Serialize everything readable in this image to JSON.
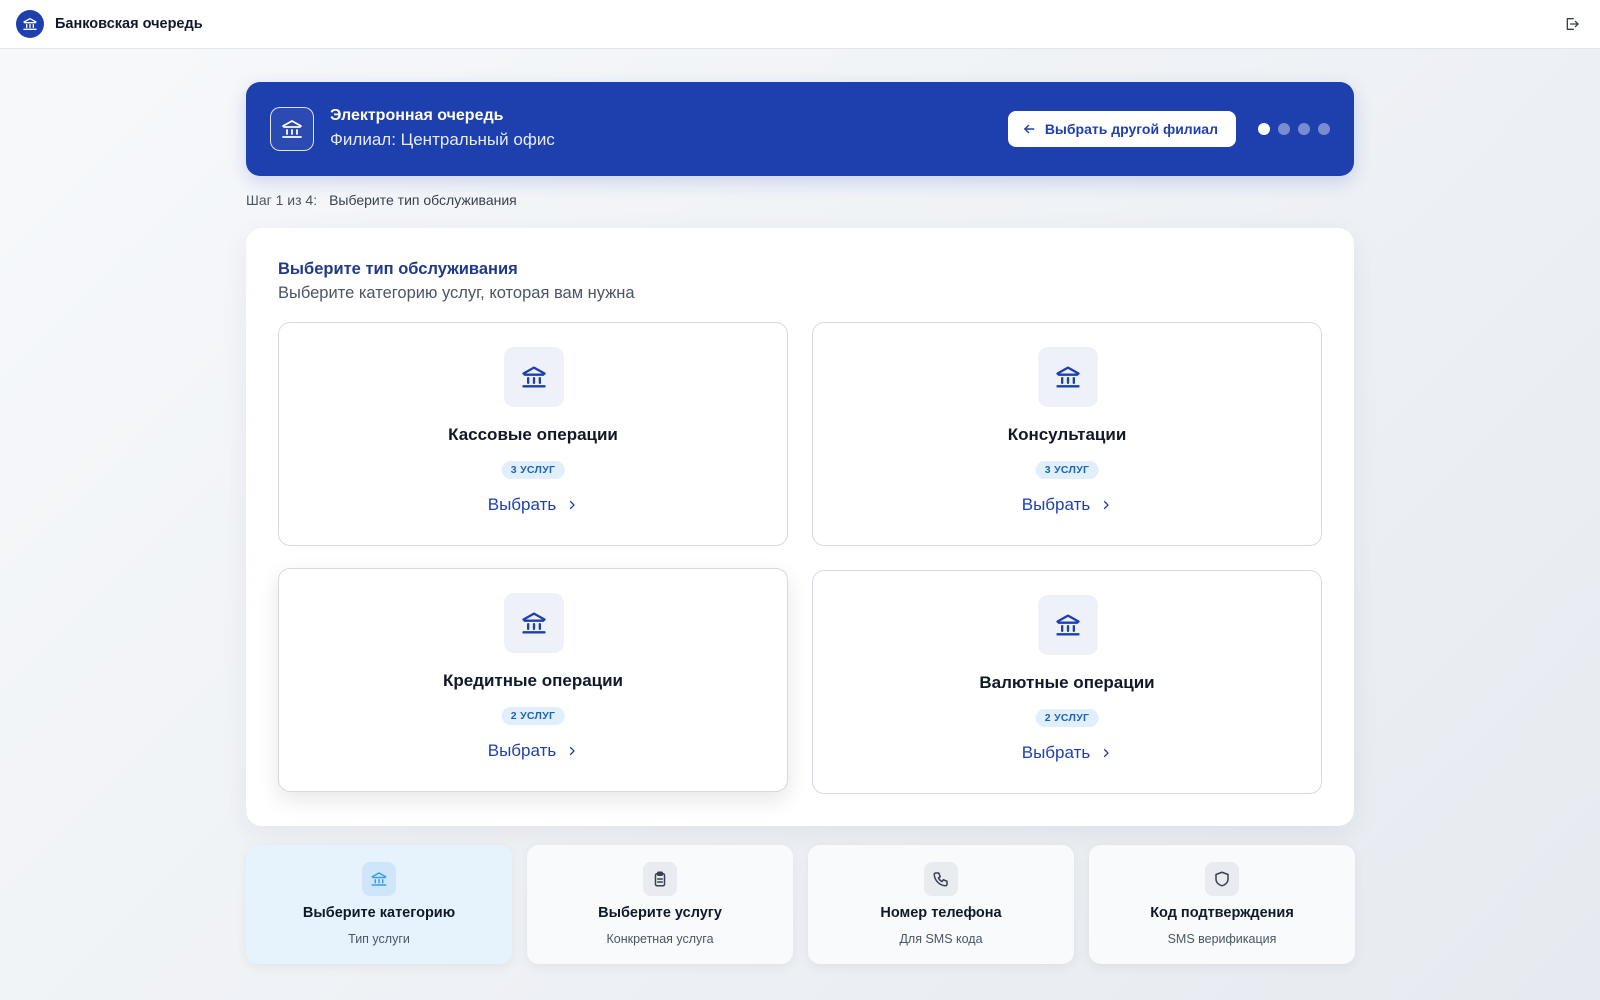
{
  "header": {
    "app_title": "Банковская очередь",
    "logo_icon": "bank-icon",
    "logout_icon": "logout-icon"
  },
  "hero": {
    "title": "Электронная очередь",
    "subtitle": "Филиал: Центральный офис",
    "change_branch_label": "Выбрать другой филиал",
    "steps_total": 4,
    "current_step": 1
  },
  "progress": {
    "step_counter": "Шаг 1 из 4:",
    "step_name": "Выберите тип обслуживания"
  },
  "panel": {
    "title": "Выберите тип обслуживания",
    "subtitle": "Выберите категорию услуг, которая вам нужна"
  },
  "categories": [
    {
      "title": "Кассовые операции",
      "badge": "3 УСЛУГ",
      "action": "Выбрать",
      "icon": "bank-icon"
    },
    {
      "title": "Консультации",
      "badge": "3 УСЛУГ",
      "action": "Выбрать",
      "icon": "bank-icon"
    },
    {
      "title": "Кредитные операции",
      "badge": "2 УСЛУГ",
      "action": "Выбрать",
      "icon": "bank-icon"
    },
    {
      "title": "Валютные операции",
      "badge": "2 УСЛУГ",
      "action": "Выбрать",
      "icon": "bank-icon"
    }
  ],
  "steps": [
    {
      "title": "Выберите категорию",
      "subtitle": "Тип услуги",
      "icon": "bank-icon",
      "active": true
    },
    {
      "title": "Выберите услугу",
      "subtitle": "Конкретная услуга",
      "icon": "clipboard-icon",
      "active": false
    },
    {
      "title": "Номер телефона",
      "subtitle": "Для SMS кода",
      "icon": "phone-icon",
      "active": false
    },
    {
      "title": "Код подтверждения",
      "subtitle": "SMS верификация",
      "icon": "shield-icon",
      "active": false
    }
  ],
  "colors": {
    "primary": "#1e40af",
    "heading": "#1e3a8a",
    "badge_bg": "#e0effb",
    "badge_text": "#1e64b4",
    "active_step_bg": "#e6f3fd"
  }
}
